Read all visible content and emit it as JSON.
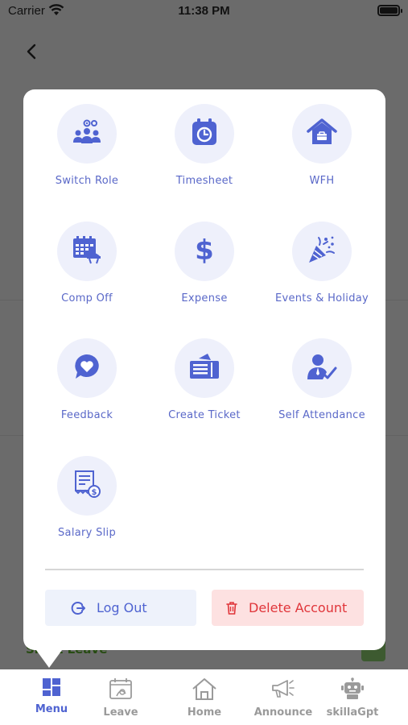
{
  "status_bar": {
    "carrier": "Carrier",
    "time": "11:38 PM"
  },
  "background": {
    "partial_text": "Short Leave"
  },
  "menu": {
    "items": [
      {
        "label": "Switch Role",
        "icon": "switch-role-icon"
      },
      {
        "label": "Timesheet",
        "icon": "timesheet-icon"
      },
      {
        "label": "WFH",
        "icon": "wfh-icon"
      },
      {
        "label": "Comp Off",
        "icon": "comp-off-icon"
      },
      {
        "label": "Expense",
        "icon": "expense-icon"
      },
      {
        "label": "Events & Holiday",
        "icon": "events-holiday-icon"
      },
      {
        "label": "Feedback",
        "icon": "feedback-icon"
      },
      {
        "label": "Create Ticket",
        "icon": "create-ticket-icon"
      },
      {
        "label": "Self Attendance",
        "icon": "self-attendance-icon"
      },
      {
        "label": "Salary Slip",
        "icon": "salary-slip-icon"
      }
    ],
    "logout_label": "Log Out",
    "delete_label": "Delete Account"
  },
  "tabbar": {
    "tabs": [
      {
        "label": "Menu",
        "active": true
      },
      {
        "label": "Leave",
        "active": false
      },
      {
        "label": "Home",
        "active": false
      },
      {
        "label": "Announce",
        "active": false
      },
      {
        "label": "skillaGpt",
        "active": false
      }
    ]
  },
  "colors": {
    "accent": "#4f63d1",
    "danger": "#e0353a",
    "icon_bg": "#eef0fb",
    "inactive": "#9a9a9a"
  }
}
